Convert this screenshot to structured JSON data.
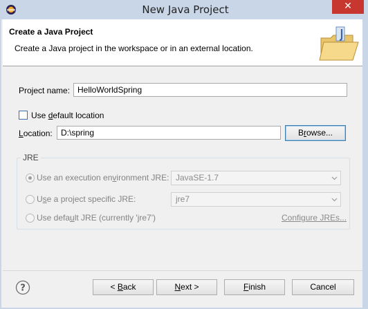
{
  "window": {
    "title": "New Java Project",
    "close_label": "✕"
  },
  "header": {
    "title": "Create a Java Project",
    "description": "Create a Java project in the workspace or in an external location."
  },
  "project": {
    "name_label_pre": "Project name:",
    "name_value": "HelloWorldSpring",
    "default_location_label_pre": "Use ",
    "default_location_label_key": "d",
    "default_location_label_post": "efault location",
    "default_location_checked": false,
    "location_label_key": "L",
    "location_label_post": "ocation:",
    "location_value": "D:\\spring",
    "browse_label_pre": "B",
    "browse_label_key": "r",
    "browse_label_post": "owse..."
  },
  "jre": {
    "group_label": "JRE",
    "options": [
      {
        "pre": "Use an execution en",
        "key": "v",
        "post": "ironment JRE:",
        "selected": true,
        "combo": "JavaSE-1.7"
      },
      {
        "pre": "U",
        "key": "s",
        "post": "e a project specific JRE:",
        "selected": false,
        "combo": "jre7"
      },
      {
        "pre": "Use defa",
        "key": "u",
        "post": "lt JRE (currently 'jre7')",
        "selected": false,
        "link": "Configure JREs..."
      }
    ]
  },
  "footer": {
    "back_pre": "< ",
    "back_key": "B",
    "back_post": "ack",
    "next_pre": "",
    "next_key": "N",
    "next_post": "ext >",
    "finish_pre": "",
    "finish_key": "F",
    "finish_post": "inish",
    "cancel_label": "Cancel"
  },
  "colors": {
    "titlebar": "#c9d6e8",
    "close": "#c7372f",
    "focus_border": "#3c7fb1"
  }
}
